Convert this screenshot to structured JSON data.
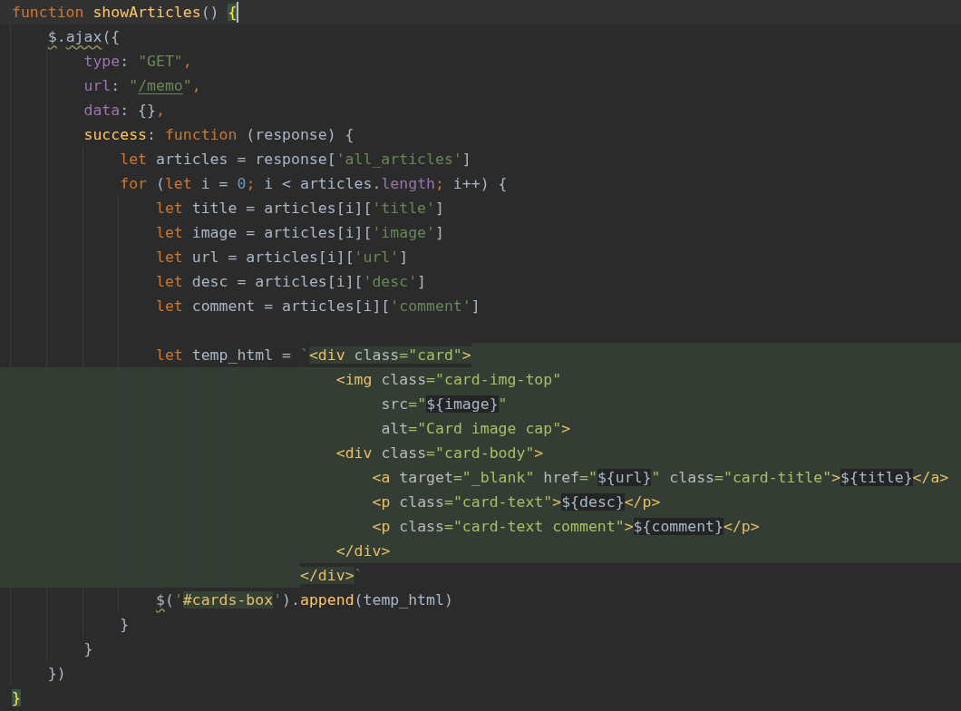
{
  "editor": {
    "lines": [
      {
        "kind": "plain",
        "current": true,
        "tokens": [
          {
            "kind": "keyword",
            "text": "function "
          },
          {
            "kind": "fn",
            "text": "showArticles"
          },
          {
            "kind": "plain",
            "text": "() "
          },
          {
            "kind": "brace",
            "text": "{"
          }
        ]
      },
      {
        "kind": "plain",
        "current": false,
        "tokens": [
          {
            "kind": "warn",
            "text": "    $"
          },
          {
            "kind": "plain",
            "text": "."
          },
          {
            "kind": "warn",
            "text": "ajax"
          },
          {
            "kind": "plain",
            "text": "({"
          }
        ]
      },
      {
        "kind": "plain",
        "current": false,
        "tokens": [
          {
            "kind": "prop",
            "text": "        type"
          },
          {
            "kind": "plain",
            "text": ": "
          },
          {
            "kind": "string",
            "text": "\"GET\""
          },
          {
            "kind": "keyword",
            "text": ","
          }
        ]
      },
      {
        "kind": "plain",
        "current": false,
        "tokens": [
          {
            "kind": "prop",
            "text": "        url"
          },
          {
            "kind": "plain",
            "text": ": "
          },
          {
            "kind": "string",
            "text": "\""
          },
          {
            "kind": "link",
            "text": "/memo"
          },
          {
            "kind": "string",
            "text": "\""
          },
          {
            "kind": "keyword",
            "text": ","
          }
        ]
      },
      {
        "kind": "plain",
        "current": false,
        "tokens": [
          {
            "kind": "prop",
            "text": "        data"
          },
          {
            "kind": "plain",
            "text": ": {}"
          },
          {
            "kind": "keyword",
            "text": ","
          }
        ]
      },
      {
        "kind": "plain",
        "current": false,
        "tokens": [
          {
            "kind": "fn",
            "text": "        success"
          },
          {
            "kind": "plain",
            "text": ": "
          },
          {
            "kind": "keyword",
            "text": "function "
          },
          {
            "kind": "plain",
            "text": "(response) {"
          }
        ]
      },
      {
        "kind": "plain",
        "current": false,
        "tokens": [
          {
            "kind": "keyword",
            "text": "            let "
          },
          {
            "kind": "plain",
            "text": "articles = response["
          },
          {
            "kind": "string",
            "text": "'all_articles'"
          },
          {
            "kind": "plain",
            "text": "]"
          }
        ]
      },
      {
        "kind": "plain",
        "current": false,
        "tokens": [
          {
            "kind": "keyword",
            "text": "            for "
          },
          {
            "kind": "plain",
            "text": "("
          },
          {
            "kind": "keyword",
            "text": "let "
          },
          {
            "kind": "plain",
            "text": "i = "
          },
          {
            "kind": "number",
            "text": "0"
          },
          {
            "kind": "keyword",
            "text": ";"
          },
          {
            "kind": "plain",
            "text": " i < articles."
          },
          {
            "kind": "prop",
            "text": "length"
          },
          {
            "kind": "keyword",
            "text": ";"
          },
          {
            "kind": "plain",
            "text": " i++) {"
          }
        ]
      },
      {
        "kind": "plain",
        "current": false,
        "tokens": [
          {
            "kind": "keyword",
            "text": "                let "
          },
          {
            "kind": "plain",
            "text": "title = articles[i]["
          },
          {
            "kind": "string",
            "text": "'title'"
          },
          {
            "kind": "plain",
            "text": "]"
          }
        ]
      },
      {
        "kind": "plain",
        "current": false,
        "tokens": [
          {
            "kind": "keyword",
            "text": "                let "
          },
          {
            "kind": "plain",
            "text": "image = articles[i]["
          },
          {
            "kind": "string",
            "text": "'image'"
          },
          {
            "kind": "plain",
            "text": "]"
          }
        ]
      },
      {
        "kind": "plain",
        "current": false,
        "tokens": [
          {
            "kind": "keyword",
            "text": "                let "
          },
          {
            "kind": "plain",
            "text": "url = articles[i]["
          },
          {
            "kind": "string",
            "text": "'url'"
          },
          {
            "kind": "plain",
            "text": "]"
          }
        ]
      },
      {
        "kind": "plain",
        "current": false,
        "tokens": [
          {
            "kind": "keyword",
            "text": "                let "
          },
          {
            "kind": "plain",
            "text": "desc = articles[i]["
          },
          {
            "kind": "string",
            "text": "'desc'"
          },
          {
            "kind": "plain",
            "text": "]"
          }
        ]
      },
      {
        "kind": "plain",
        "current": false,
        "tokens": [
          {
            "kind": "keyword",
            "text": "                let "
          },
          {
            "kind": "plain",
            "text": "comment = articles[i]["
          },
          {
            "kind": "string",
            "text": "'comment'"
          },
          {
            "kind": "plain",
            "text": "]"
          }
        ]
      },
      {
        "kind": "blank",
        "current": false
      },
      {
        "kind": "opens",
        "current": false,
        "tokens": [
          {
            "kind": "keyword",
            "text": "                let ",
            "injected": false
          },
          {
            "kind": "plain",
            "text": "temp_html = ",
            "injected": false
          },
          {
            "kind": "string",
            "text": "`",
            "injected": false
          },
          {
            "kind": "tag",
            "text": "<div",
            "injected": true
          },
          {
            "kind": "attr",
            "text": " class",
            "injected": true
          },
          {
            "kind": "value",
            "text": "=\"card\"",
            "injected": true
          },
          {
            "kind": "tag",
            "text": ">",
            "injected": true
          }
        ]
      },
      {
        "kind": "injected",
        "current": false,
        "tokens": [
          {
            "kind": "tag",
            "text": "                                    <img"
          },
          {
            "kind": "attr",
            "text": " class"
          },
          {
            "kind": "value",
            "text": "=\"card-img-top\""
          }
        ]
      },
      {
        "kind": "injected",
        "current": false,
        "tokens": [
          {
            "kind": "attr",
            "text": "                                         src"
          },
          {
            "kind": "value",
            "text": "=\""
          },
          {
            "kind": "interp",
            "text": "${image}"
          },
          {
            "kind": "value",
            "text": "\""
          }
        ]
      },
      {
        "kind": "injected",
        "current": false,
        "tokens": [
          {
            "kind": "attr",
            "text": "                                         alt"
          },
          {
            "kind": "value",
            "text": "=\"Card image cap\""
          },
          {
            "kind": "tag",
            "text": ">"
          }
        ]
      },
      {
        "kind": "injected",
        "current": false,
        "tokens": [
          {
            "kind": "tag",
            "text": "                                    <div"
          },
          {
            "kind": "attr",
            "text": " class"
          },
          {
            "kind": "value",
            "text": "=\"card-body\""
          },
          {
            "kind": "tag",
            "text": ">"
          }
        ]
      },
      {
        "kind": "injected",
        "current": false,
        "tokens": [
          {
            "kind": "tag",
            "text": "                                        <a"
          },
          {
            "kind": "attr",
            "text": " target"
          },
          {
            "kind": "value",
            "text": "=\"_blank\""
          },
          {
            "kind": "attr",
            "text": " href"
          },
          {
            "kind": "value",
            "text": "=\""
          },
          {
            "kind": "interp",
            "text": "${url}"
          },
          {
            "kind": "value",
            "text": "\""
          },
          {
            "kind": "attr",
            "text": " class"
          },
          {
            "kind": "value",
            "text": "=\"card-title\""
          },
          {
            "kind": "tag",
            "text": ">"
          },
          {
            "kind": "interp",
            "text": "${title}"
          },
          {
            "kind": "tag",
            "text": "</a>"
          }
        ]
      },
      {
        "kind": "injected",
        "current": false,
        "tokens": [
          {
            "kind": "tag",
            "text": "                                        <p"
          },
          {
            "kind": "attr",
            "text": " class"
          },
          {
            "kind": "value",
            "text": "=\"card-text\""
          },
          {
            "kind": "tag",
            "text": ">"
          },
          {
            "kind": "interp",
            "text": "${desc}"
          },
          {
            "kind": "tag",
            "text": "</p>"
          }
        ]
      },
      {
        "kind": "injected",
        "current": false,
        "tokens": [
          {
            "kind": "tag",
            "text": "                                        <p"
          },
          {
            "kind": "attr",
            "text": " class"
          },
          {
            "kind": "value",
            "text": "=\"card-text comment\""
          },
          {
            "kind": "tag",
            "text": ">"
          },
          {
            "kind": "interp",
            "text": "${comment}"
          },
          {
            "kind": "tag",
            "text": "</p>"
          }
        ]
      },
      {
        "kind": "injected",
        "current": false,
        "tokens": [
          {
            "kind": "tag",
            "text": "                                    </div>"
          }
        ]
      },
      {
        "kind": "closes",
        "current": false,
        "tokens": [
          {
            "kind": "tag",
            "text": "                                </div>",
            "injected": true
          },
          {
            "kind": "string",
            "text": "`",
            "injected": false
          }
        ]
      },
      {
        "kind": "plain",
        "current": false,
        "tokens": [
          {
            "kind": "warn",
            "text": "                $"
          },
          {
            "kind": "plain",
            "text": "("
          },
          {
            "kind": "string",
            "text": "'"
          },
          {
            "kind": "selector",
            "text": "#cards-box"
          },
          {
            "kind": "string",
            "text": "'"
          },
          {
            "kind": "plain",
            "text": ")."
          },
          {
            "kind": "fn",
            "text": "append"
          },
          {
            "kind": "plain",
            "text": "(temp_html)"
          }
        ]
      },
      {
        "kind": "plain",
        "current": false,
        "tokens": [
          {
            "kind": "plain",
            "text": "            }"
          }
        ]
      },
      {
        "kind": "plain",
        "current": false,
        "tokens": [
          {
            "kind": "plain",
            "text": "        }"
          }
        ]
      },
      {
        "kind": "plain",
        "current": false,
        "tokens": [
          {
            "kind": "plain",
            "text": "    })"
          }
        ]
      },
      {
        "kind": "plain",
        "current": false,
        "tokens": [
          {
            "kind": "brace",
            "text": "}"
          }
        ]
      }
    ]
  }
}
